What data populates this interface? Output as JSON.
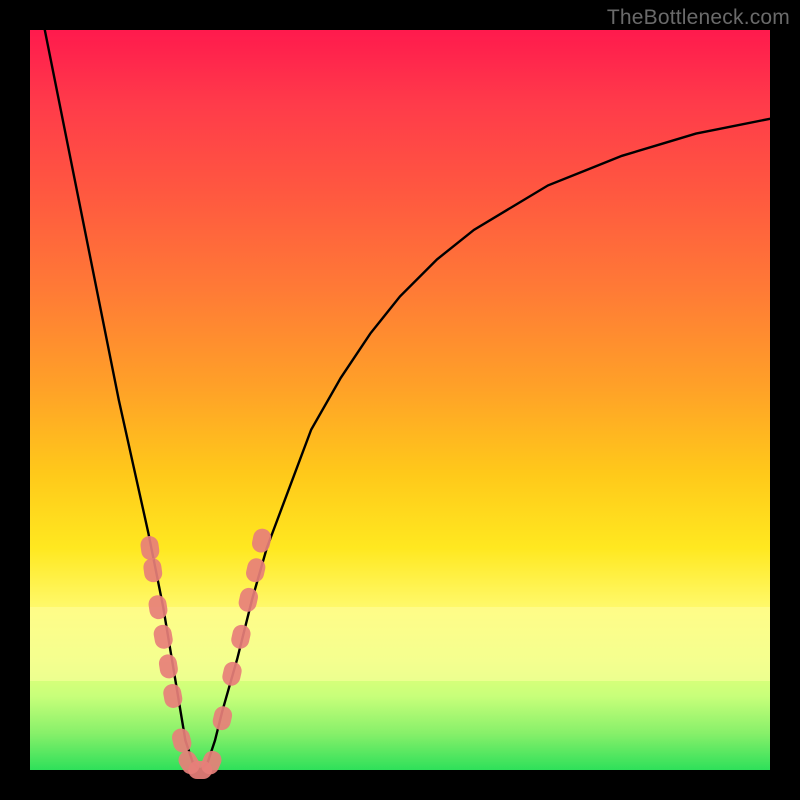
{
  "watermark": "TheBottleneck.com",
  "colors": {
    "frame": "#000000",
    "gradient_top": "#ff1a4d",
    "gradient_mid": "#ffc91a",
    "gradient_bottom": "#2ee05a",
    "curve": "#000000",
    "markers": "#e77f7a",
    "band": "#ffffa0"
  },
  "chart_data": {
    "type": "line",
    "title": "",
    "xlabel": "",
    "ylabel": "",
    "xlim": [
      0,
      100
    ],
    "ylim": [
      0,
      100
    ],
    "x": [
      2,
      4,
      6,
      8,
      10,
      12,
      14,
      16,
      17,
      18,
      19,
      20,
      21,
      22,
      23,
      24,
      25,
      26,
      28,
      30,
      32,
      35,
      38,
      42,
      46,
      50,
      55,
      60,
      65,
      70,
      75,
      80,
      85,
      90,
      95,
      100
    ],
    "y": [
      100,
      90,
      80,
      70,
      60,
      50,
      41,
      32,
      27,
      22,
      16,
      10,
      4,
      1,
      0,
      1,
      4,
      8,
      15,
      23,
      30,
      38,
      46,
      53,
      59,
      64,
      69,
      73,
      76,
      79,
      81,
      83,
      84.5,
      86,
      87,
      88
    ],
    "min_x": 23,
    "markers": {
      "x": [
        16.2,
        16.6,
        17.3,
        18.0,
        18.7,
        19.3,
        20.5,
        21.5,
        23.0,
        24.5,
        26.0,
        27.3,
        28.5,
        29.5,
        30.5,
        31.3
      ],
      "y": [
        30,
        27,
        22,
        18,
        14,
        10,
        4,
        1,
        0,
        1,
        7,
        13,
        18,
        23,
        27,
        31
      ]
    },
    "good_band_y": [
      0,
      20
    ]
  }
}
